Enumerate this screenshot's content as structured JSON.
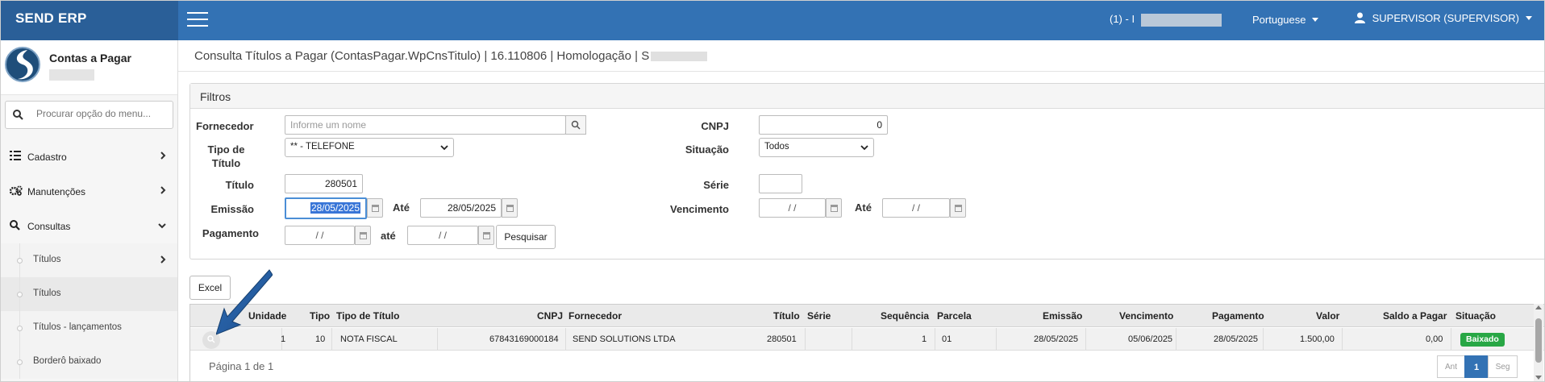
{
  "app": {
    "brand": "SEND ERP"
  },
  "header": {
    "company_prefix": "(1) - I",
    "language": "Portuguese",
    "user": "SUPERVISOR (SUPERVISOR)"
  },
  "sidebar": {
    "module_title": "Contas a Pagar",
    "search_placeholder": "Procurar opção do menu...",
    "items": [
      {
        "label": "Cadastro"
      },
      {
        "label": "Manutenções"
      },
      {
        "label": "Consultas"
      }
    ],
    "subitems": [
      {
        "label": "Títulos"
      },
      {
        "label": "Títulos"
      },
      {
        "label": "Títulos - lançamentos"
      },
      {
        "label": "Borderô baixado"
      }
    ]
  },
  "page": {
    "title": "Consulta Títulos a Pagar (ContasPagar.WpCnsTitulo) | 16.110806 | Homologação | S"
  },
  "filters": {
    "header": "Filtros",
    "fornecedor_label": "Fornecedor",
    "fornecedor_placeholder": "Informe um nome",
    "tipo_label": "Tipo de Título",
    "tipo_value": "** - TELEFONE",
    "titulo_label": "Título",
    "titulo_value": "280501",
    "emissao_label": "Emissão",
    "emissao_de": "28/05/2025",
    "ate_label": "Até",
    "emissao_ate": "28/05/2025",
    "pagamento_label": "Pagamento",
    "pagamento_de": "/ /",
    "ate_lower_label": "até",
    "pagamento_ate": "/ /",
    "pesquisar": "Pesquisar",
    "cnpj_label": "CNPJ",
    "cnpj_value": "0",
    "situacao_label": "Situação",
    "situacao_value": "Todos",
    "serie_label": "Série",
    "serie_value": "",
    "vencimento_label": "Vencimento",
    "vencimento_de": "/ /",
    "vencimento_ate": "/ /"
  },
  "toolbar": {
    "excel": "Excel"
  },
  "grid": {
    "columns": [
      "Unidade",
      "Tipo",
      "Tipo de Título",
      "CNPJ",
      "Fornecedor",
      "Título",
      "Série",
      "Sequência",
      "Parcela",
      "Emissão",
      "Vencimento",
      "Pagamento",
      "Valor",
      "Saldo a Pagar",
      "Situação"
    ],
    "rows": [
      {
        "unidade": "1",
        "tipo": "10",
        "tipo_titulo": "NOTA FISCAL",
        "cnpj": "67843169000184",
        "fornecedor": "SEND SOLUTIONS LTDA",
        "titulo": "280501",
        "serie": "",
        "sequencia": "1",
        "parcela": "01",
        "emissao": "28/05/2025",
        "vencimento": "05/06/2025",
        "pagamento": "28/05/2025",
        "valor": "1.500,00",
        "saldo": "0,00",
        "situacao": "Baixado"
      }
    ],
    "pager": "Página 1 de 1",
    "pages": {
      "prev": "Ant",
      "current": "1",
      "next": "Seg"
    }
  },
  "colors": {
    "header": "#3372b4",
    "brand_bg": "#2a5f98",
    "success": "#28a745"
  }
}
